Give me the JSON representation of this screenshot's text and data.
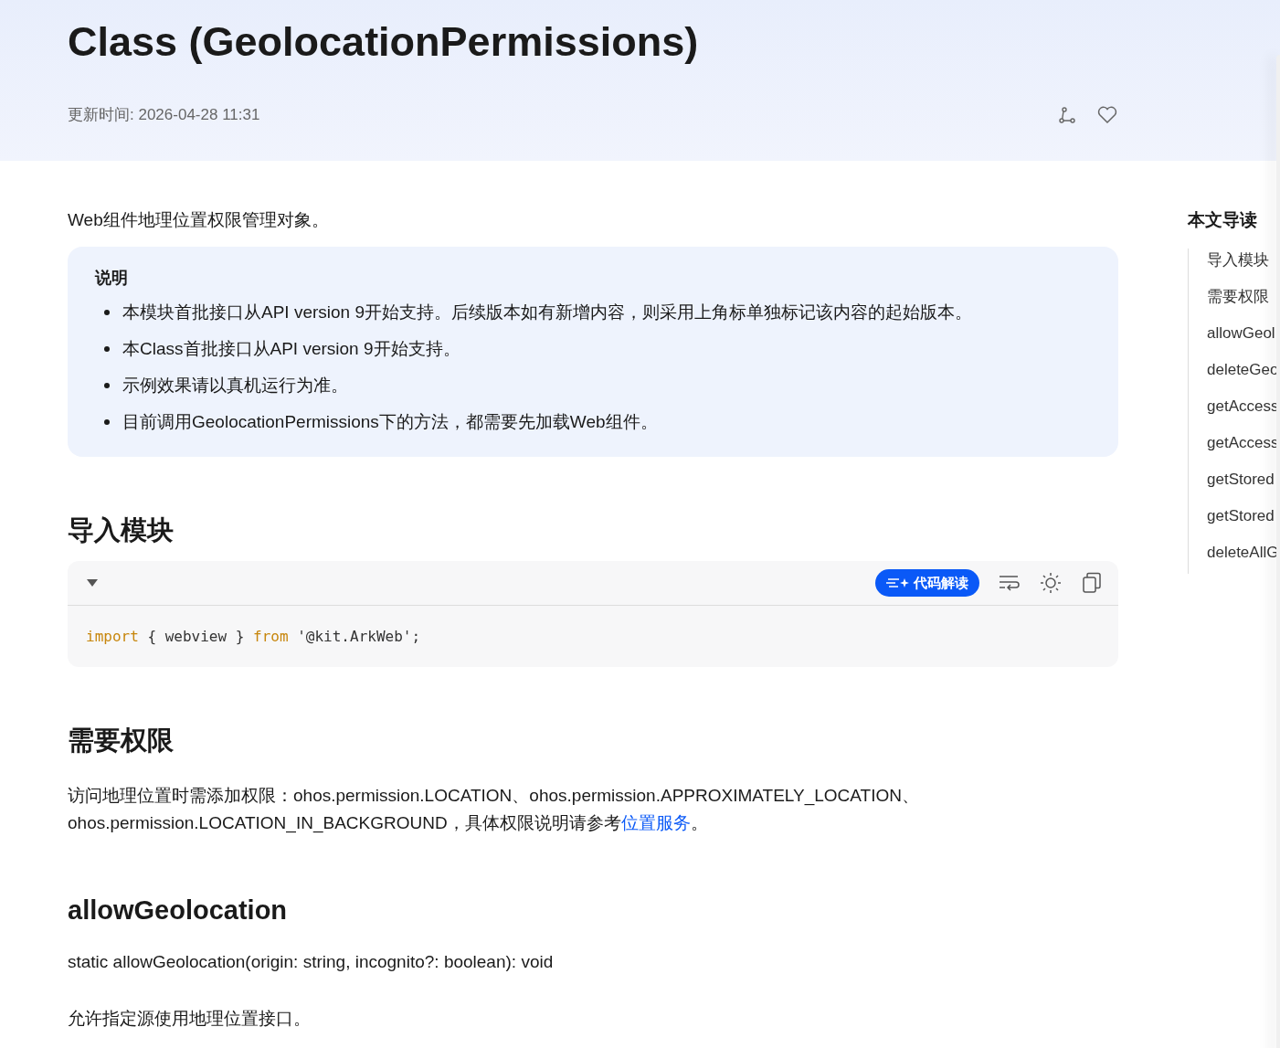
{
  "header": {
    "title": "Class (GeolocationPermissions)",
    "updated": "更新时间: 2026-04-28 11:31"
  },
  "intro": "Web组件地理位置权限管理对象。",
  "note": {
    "title": "说明",
    "items": [
      "本模块首批接口从API version 9开始支持。后续版本如有新增内容，则采用上角标单独标记该内容的起始版本。",
      "本Class首批接口从API version 9开始支持。",
      "示例效果请以真机运行为准。",
      "目前调用GeolocationPermissions下的方法，都需要先加载Web组件。"
    ]
  },
  "sections": [
    {
      "heading": "导入模块",
      "code": {
        "expanded": true,
        "ai_button": "代码解读",
        "tokens": [
          {
            "kind": "keyword",
            "text": "import"
          },
          {
            "kind": "plain",
            "text": " { webview } "
          },
          {
            "kind": "keyword",
            "text": "from"
          },
          {
            "kind": "plain",
            "text": " '@kit.ArkWeb';"
          }
        ]
      }
    },
    {
      "heading": "需要权限",
      "paragraph": [
        {
          "kind": "text",
          "text": "访问地理位置时需添加权限：ohos.permission.LOCATION、ohos.permission.APPROXIMATELY_LOCATION、ohos.permission.LOCATION_IN_BACKGROUND，具体权限说明请参考"
        },
        {
          "kind": "link",
          "text": "位置服务"
        },
        {
          "kind": "text",
          "text": "。"
        }
      ]
    },
    {
      "heading": "allowGeolocation",
      "signature": "static allowGeolocation(origin: string, incognito?: boolean): void",
      "description": "允许指定源使用地理位置接口。"
    }
  ],
  "toc": {
    "title": "本文导读",
    "items": [
      "导入模块",
      "需要权限",
      "allowGeol",
      "deleteGeo",
      "getAccess",
      "getAccess",
      "getStored",
      "getStored",
      "deleteAllG"
    ]
  }
}
